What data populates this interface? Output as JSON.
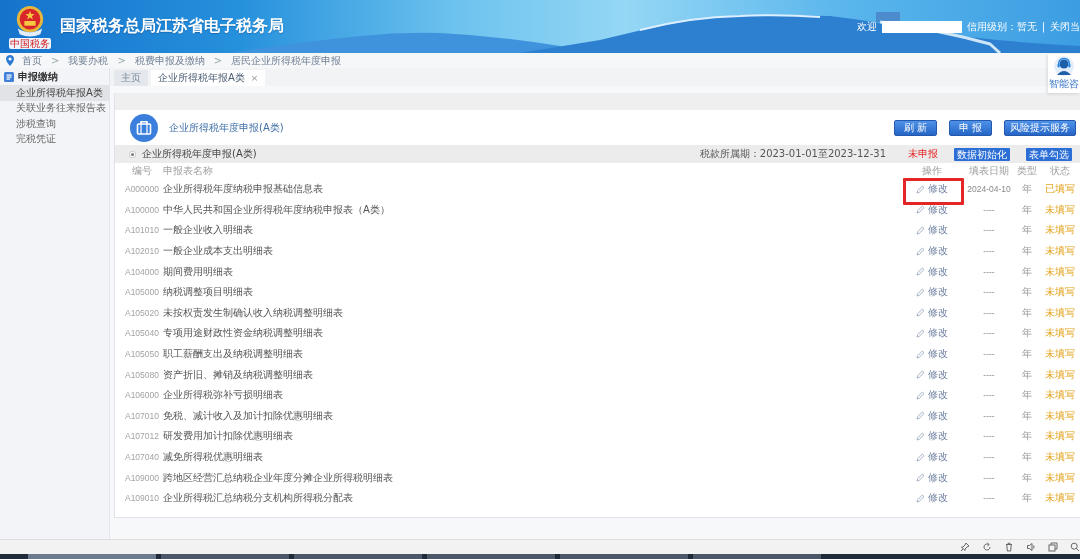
{
  "header": {
    "logo_caption": "中国税务",
    "title": "国家税务总局江苏省电子税务局",
    "welcome": "欢迎",
    "credit": "信用级别：暂无",
    "divider": "|",
    "close_link": "关闭当"
  },
  "breadcrumb": [
    {
      "kind": "link",
      "text": "首页"
    },
    {
      "kind": "separator",
      "text": ">"
    },
    {
      "kind": "link",
      "text": "我要办税"
    },
    {
      "kind": "separator",
      "text": ">"
    },
    {
      "kind": "link",
      "text": "税费申报及缴纳"
    },
    {
      "kind": "separator",
      "text": ">"
    },
    {
      "kind": "link",
      "text": "居民企业所得税年度申报"
    }
  ],
  "assistant": {
    "label": "智能咨"
  },
  "sidebar": {
    "title": "申报缴纳",
    "items": [
      {
        "label": "企业所得税年报A类",
        "selected": true
      },
      {
        "label": "关联业务往来报告表",
        "selected": false
      },
      {
        "label": "涉税查询",
        "selected": false
      },
      {
        "label": "完税凭证",
        "selected": false
      }
    ]
  },
  "tabs": [
    {
      "label": "主页",
      "selected": false
    },
    {
      "label": "企业所得税年报A类",
      "selected": true,
      "close": "×"
    }
  ],
  "panel": {
    "title": "企业所得税年度申报(A类)",
    "buttons": [
      "刷 新",
      "申 报",
      "风险提示服务"
    ]
  },
  "group": {
    "title": "企业所得税年度申报(A类)",
    "period": "税款所属期：2023-01-01至2023-12-31",
    "status": "未申报",
    "buttons": [
      "数据初始化",
      "表单勾选"
    ]
  },
  "table": {
    "columns": [
      "编号",
      "申报表名称",
      "操作",
      "填表日期",
      "类型",
      "状态"
    ],
    "rows": [
      {
        "code": "A000000",
        "name": "企业所得税年度纳税申报基础信息表",
        "action": "修改",
        "date": "2024-04-10",
        "type": "年",
        "status": "已填写",
        "highlighted": true
      },
      {
        "code": "A100000",
        "name": "中华人民共和国企业所得税年度纳税申报表（A类）",
        "action": "修改",
        "date": "----",
        "type": "年",
        "status": "未填写",
        "highlighted": false
      },
      {
        "code": "A101010",
        "name": "一般企业收入明细表",
        "action": "修改",
        "date": "----",
        "type": "年",
        "status": "未填写",
        "highlighted": false
      },
      {
        "code": "A102010",
        "name": "一般企业成本支出明细表",
        "action": "修改",
        "date": "----",
        "type": "年",
        "status": "未填写",
        "highlighted": false
      },
      {
        "code": "A104000",
        "name": "期间费用明细表",
        "action": "修改",
        "date": "----",
        "type": "年",
        "status": "未填写",
        "highlighted": false
      },
      {
        "code": "A105000",
        "name": "纳税调整项目明细表",
        "action": "修改",
        "date": "----",
        "type": "年",
        "status": "未填写",
        "highlighted": false
      },
      {
        "code": "A105020",
        "name": "未按权责发生制确认收入纳税调整明细表",
        "action": "修改",
        "date": "----",
        "type": "年",
        "status": "未填写",
        "highlighted": false
      },
      {
        "code": "A105040",
        "name": "专项用途财政性资金纳税调整明细表",
        "action": "修改",
        "date": "----",
        "type": "年",
        "status": "未填写",
        "highlighted": false
      },
      {
        "code": "A105050",
        "name": "职工薪酬支出及纳税调整明细表",
        "action": "修改",
        "date": "----",
        "type": "年",
        "status": "未填写",
        "highlighted": false
      },
      {
        "code": "A105080",
        "name": "资产折旧、摊销及纳税调整明细表",
        "action": "修改",
        "date": "----",
        "type": "年",
        "status": "未填写",
        "highlighted": false
      },
      {
        "code": "A106000",
        "name": "企业所得税弥补亏损明细表",
        "action": "修改",
        "date": "----",
        "type": "年",
        "status": "未填写",
        "highlighted": false
      },
      {
        "code": "A107010",
        "name": "免税、减计收入及加计扣除优惠明细表",
        "action": "修改",
        "date": "----",
        "type": "年",
        "status": "未填写",
        "highlighted": false
      },
      {
        "code": "A107012",
        "name": "研发费用加计扣除优惠明细表",
        "action": "修改",
        "date": "----",
        "type": "年",
        "status": "未填写",
        "highlighted": false
      },
      {
        "code": "A107040",
        "name": "减免所得税优惠明细表",
        "action": "修改",
        "date": "----",
        "type": "年",
        "status": "未填写",
        "highlighted": false
      },
      {
        "code": "A109000",
        "name": "跨地区经营汇总纳税企业年度分摊企业所得税明细表",
        "action": "修改",
        "date": "----",
        "type": "年",
        "status": "未填写",
        "highlighted": false
      },
      {
        "code": "A109010",
        "name": "企业所得税汇总纳税分支机构所得税分配表",
        "action": "修改",
        "date": "----",
        "type": "年",
        "status": "未填写",
        "highlighted": false
      }
    ]
  }
}
